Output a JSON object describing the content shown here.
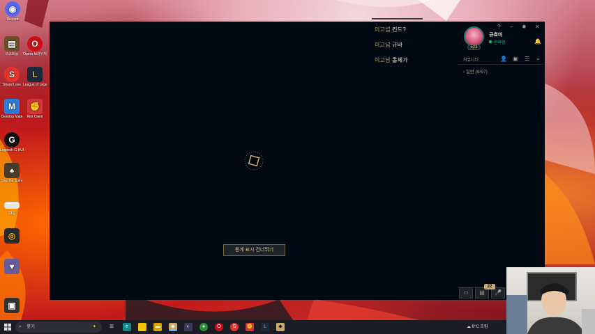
{
  "desktop": {
    "icons": [
      {
        "label": "Discord",
        "glyph": "◉",
        "color": "#5865f2"
      },
      {
        "label": "리스트를",
        "glyph": "▤",
        "color": "#6b4f2a"
      },
      {
        "label": "Opera 브라우저",
        "glyph": "O",
        "color": "#cc0f16"
      },
      {
        "label": "ShareX.exe",
        "glyph": "S",
        "color": "#e8322b"
      },
      {
        "label": "League of Legends",
        "glyph": "L",
        "color": "#1b2a3a"
      },
      {
        "label": "Desktop Mate",
        "glyph": "M",
        "color": "#2b7bd8"
      },
      {
        "label": "Riot Client",
        "glyph": "✊",
        "color": "#d13639"
      },
      {
        "label": "Logitech G HUB",
        "glyph": "G",
        "color": "#111111"
      },
      {
        "label": "Slay the Spire",
        "glyph": "♠",
        "color": "#4a3b2a"
      },
      {
        "label": "23통",
        "glyph": "",
        "color": "#e8e8e8"
      },
      {
        "label": "",
        "glyph": "◎",
        "color": "#2a2a2a"
      },
      {
        "label": "",
        "glyph": "♥",
        "color": "#6a5a9a"
      },
      {
        "label": "",
        "glyph": "▣",
        "color": "#333333"
      }
    ]
  },
  "client": {
    "skip_button": "통계 표시 건너뛰기",
    "toasts": [
      {
        "who": "이고넘",
        "msg": "킨드?"
      },
      {
        "who": "이고넘",
        "msg": "규바"
      },
      {
        "who": "이고넘",
        "msg": "롤체가"
      }
    ],
    "window_controls": {
      "help": "?",
      "minimize": "–",
      "settings": "✹",
      "close": "✕"
    },
    "profile": {
      "name": "규효미",
      "status": "온라인",
      "level": "523"
    },
    "social": {
      "community_label": "커뮤니티",
      "group": "일반 (9/97)"
    },
    "bottom_badge": "22"
  },
  "taskbar": {
    "search_placeholder": "찾기",
    "weather": "8°C  흐림"
  },
  "colors": {
    "client_bg": "#010a13",
    "gold": "#c8aa6e",
    "online": "#0acf83"
  }
}
